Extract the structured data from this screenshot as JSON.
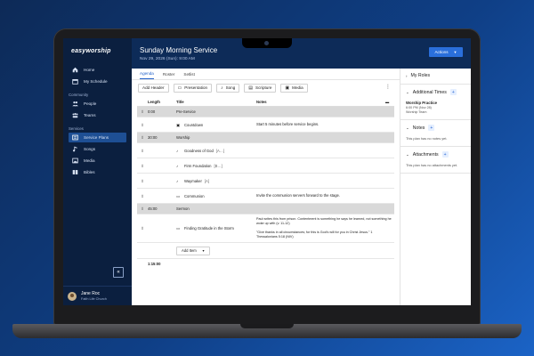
{
  "app": {
    "logo": "easyworship"
  },
  "sidebar": {
    "items": [
      {
        "label": "Home",
        "icon": "home-icon"
      },
      {
        "label": "My Schedule",
        "icon": "calendar-icon"
      }
    ],
    "community_title": "Community",
    "community": [
      {
        "label": "People",
        "icon": "people-icon"
      },
      {
        "label": "Teams",
        "icon": "teams-icon"
      }
    ],
    "services_title": "Services",
    "services": [
      {
        "label": "Service Plans",
        "icon": "service-plans-icon",
        "active": true
      },
      {
        "label": "Songs",
        "icon": "music-note-icon"
      },
      {
        "label": "Media",
        "icon": "media-icon"
      },
      {
        "label": "Bibles",
        "icon": "book-icon"
      }
    ],
    "collapse_label": "«",
    "user": {
      "name": "Jane Roc",
      "org": "Faith Life Church"
    }
  },
  "header": {
    "title": "Sunday Morning Service",
    "date": "Nov 29, 2026 (Sun): 9:00 AM",
    "actions_label": "Actions"
  },
  "tabs": [
    "Agenda",
    "Roster",
    "Setlist"
  ],
  "toolbar": {
    "add_header": "Add Header",
    "presentation": "Presentation",
    "song": "Song",
    "scripture": "Scripture",
    "media": "Media"
  },
  "grid": {
    "headers": {
      "length": "Length",
      "title": "Title",
      "notes": "Notes"
    },
    "rows": [
      {
        "kind": "section",
        "length": "0:00",
        "title": "Pre-Service"
      },
      {
        "kind": "item",
        "icon": "media-icon",
        "length": "",
        "title": "Countdown",
        "keys": "",
        "notes": "Start 5 minutes before service begins."
      },
      {
        "kind": "section",
        "length": "30:00",
        "title": "Worship"
      },
      {
        "kind": "item",
        "icon": "music-note-icon",
        "length": "",
        "title": "Goodness of God",
        "keys": "[A…]",
        "notes": ""
      },
      {
        "kind": "item",
        "icon": "music-note-icon",
        "length": "",
        "title": "Firm Foundation",
        "keys": "[B…]",
        "notes": ""
      },
      {
        "kind": "item",
        "icon": "music-note-icon",
        "length": "",
        "title": "Waymaker",
        "keys": "[A]",
        "notes": ""
      },
      {
        "kind": "item",
        "icon": "presentation-icon",
        "length": "",
        "title": "Communion",
        "keys": "",
        "notes": "Invite the communion servers forward to the stage."
      },
      {
        "kind": "section",
        "length": "45:00",
        "title": "Sermon"
      },
      {
        "kind": "item",
        "icon": "presentation-icon",
        "length": "",
        "title": "Finding Gratitude in the Storm",
        "keys": "",
        "notes": "Paul writes this from prison. Contentment is something he says he learned, not something he woke up with (v. 11-12)\n\n\"Give thanks in all circumstances; for this is God's will for you in Christ Jesus.\" 1 Thessalonians 5:18 (NIV)"
      }
    ],
    "add_item_label": "Add Item",
    "total": "1:15:00"
  },
  "panel": {
    "my_roles": "My Roles",
    "additional_times": "Additional Times",
    "event": {
      "title": "Worship Practice",
      "line1": "6:00 PM (Nov 28)",
      "line2": "Worship Team"
    },
    "notes_title": "Notes",
    "notes_empty": "This plan has no notes yet.",
    "attachments_title": "Attachments",
    "attachments_empty": "This plan has no attachments yet."
  },
  "colors": {
    "sidebar": "#0b1f3f",
    "header": "#0d2b58",
    "accent": "#2a6fdb"
  }
}
